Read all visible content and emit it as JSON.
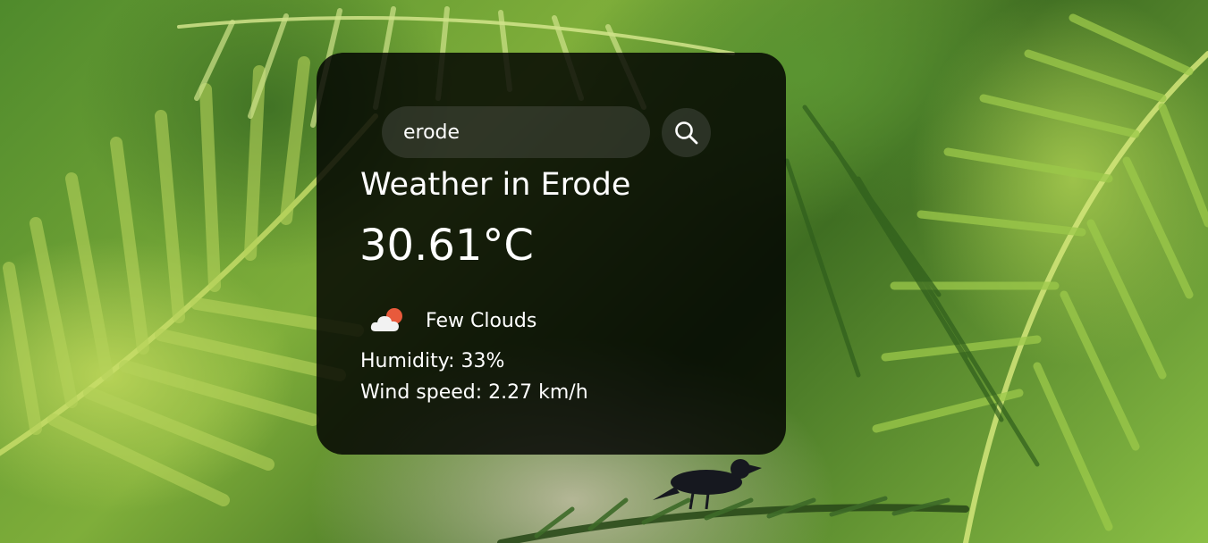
{
  "search": {
    "value": "erode",
    "button_icon": "search-icon"
  },
  "weather": {
    "title": "Weather in Erode",
    "temperature": "30.61°C",
    "condition_icon": "few-clouds-icon",
    "condition": "Few Clouds",
    "humidity": "Humidity: 33%",
    "wind": "Wind speed: 2.27 km/h"
  },
  "colors": {
    "card_background": "#000000",
    "text": "#ffffff",
    "cloud": "#f2f2f2",
    "sun": "#e85a3c"
  }
}
